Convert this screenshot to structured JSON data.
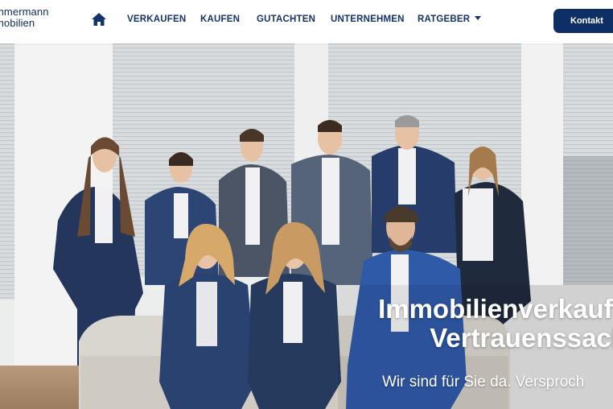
{
  "logo": {
    "line1": "mmermann",
    "line2": "mobilien"
  },
  "nav": {
    "home_icon": "home-icon",
    "items": [
      {
        "label": "VERKAUFEN"
      },
      {
        "label": "KAUFEN"
      },
      {
        "label": "GUTACHTEN"
      },
      {
        "label": "UNTERNEHMEN"
      },
      {
        "label": "RATGEBER"
      }
    ],
    "ratgeber_icon": "caret-down-icon",
    "contact_label": "Kontakt"
  },
  "hero": {
    "headline_line1": "Immobilienverkauf i",
    "headline_line2": "Vertrauenssach",
    "subline": "Wir sind für Sie da. Versproch"
  },
  "colors": {
    "brand": "#0e2f66",
    "nav_text": "#14336b",
    "suit_blue": "#27406f"
  }
}
